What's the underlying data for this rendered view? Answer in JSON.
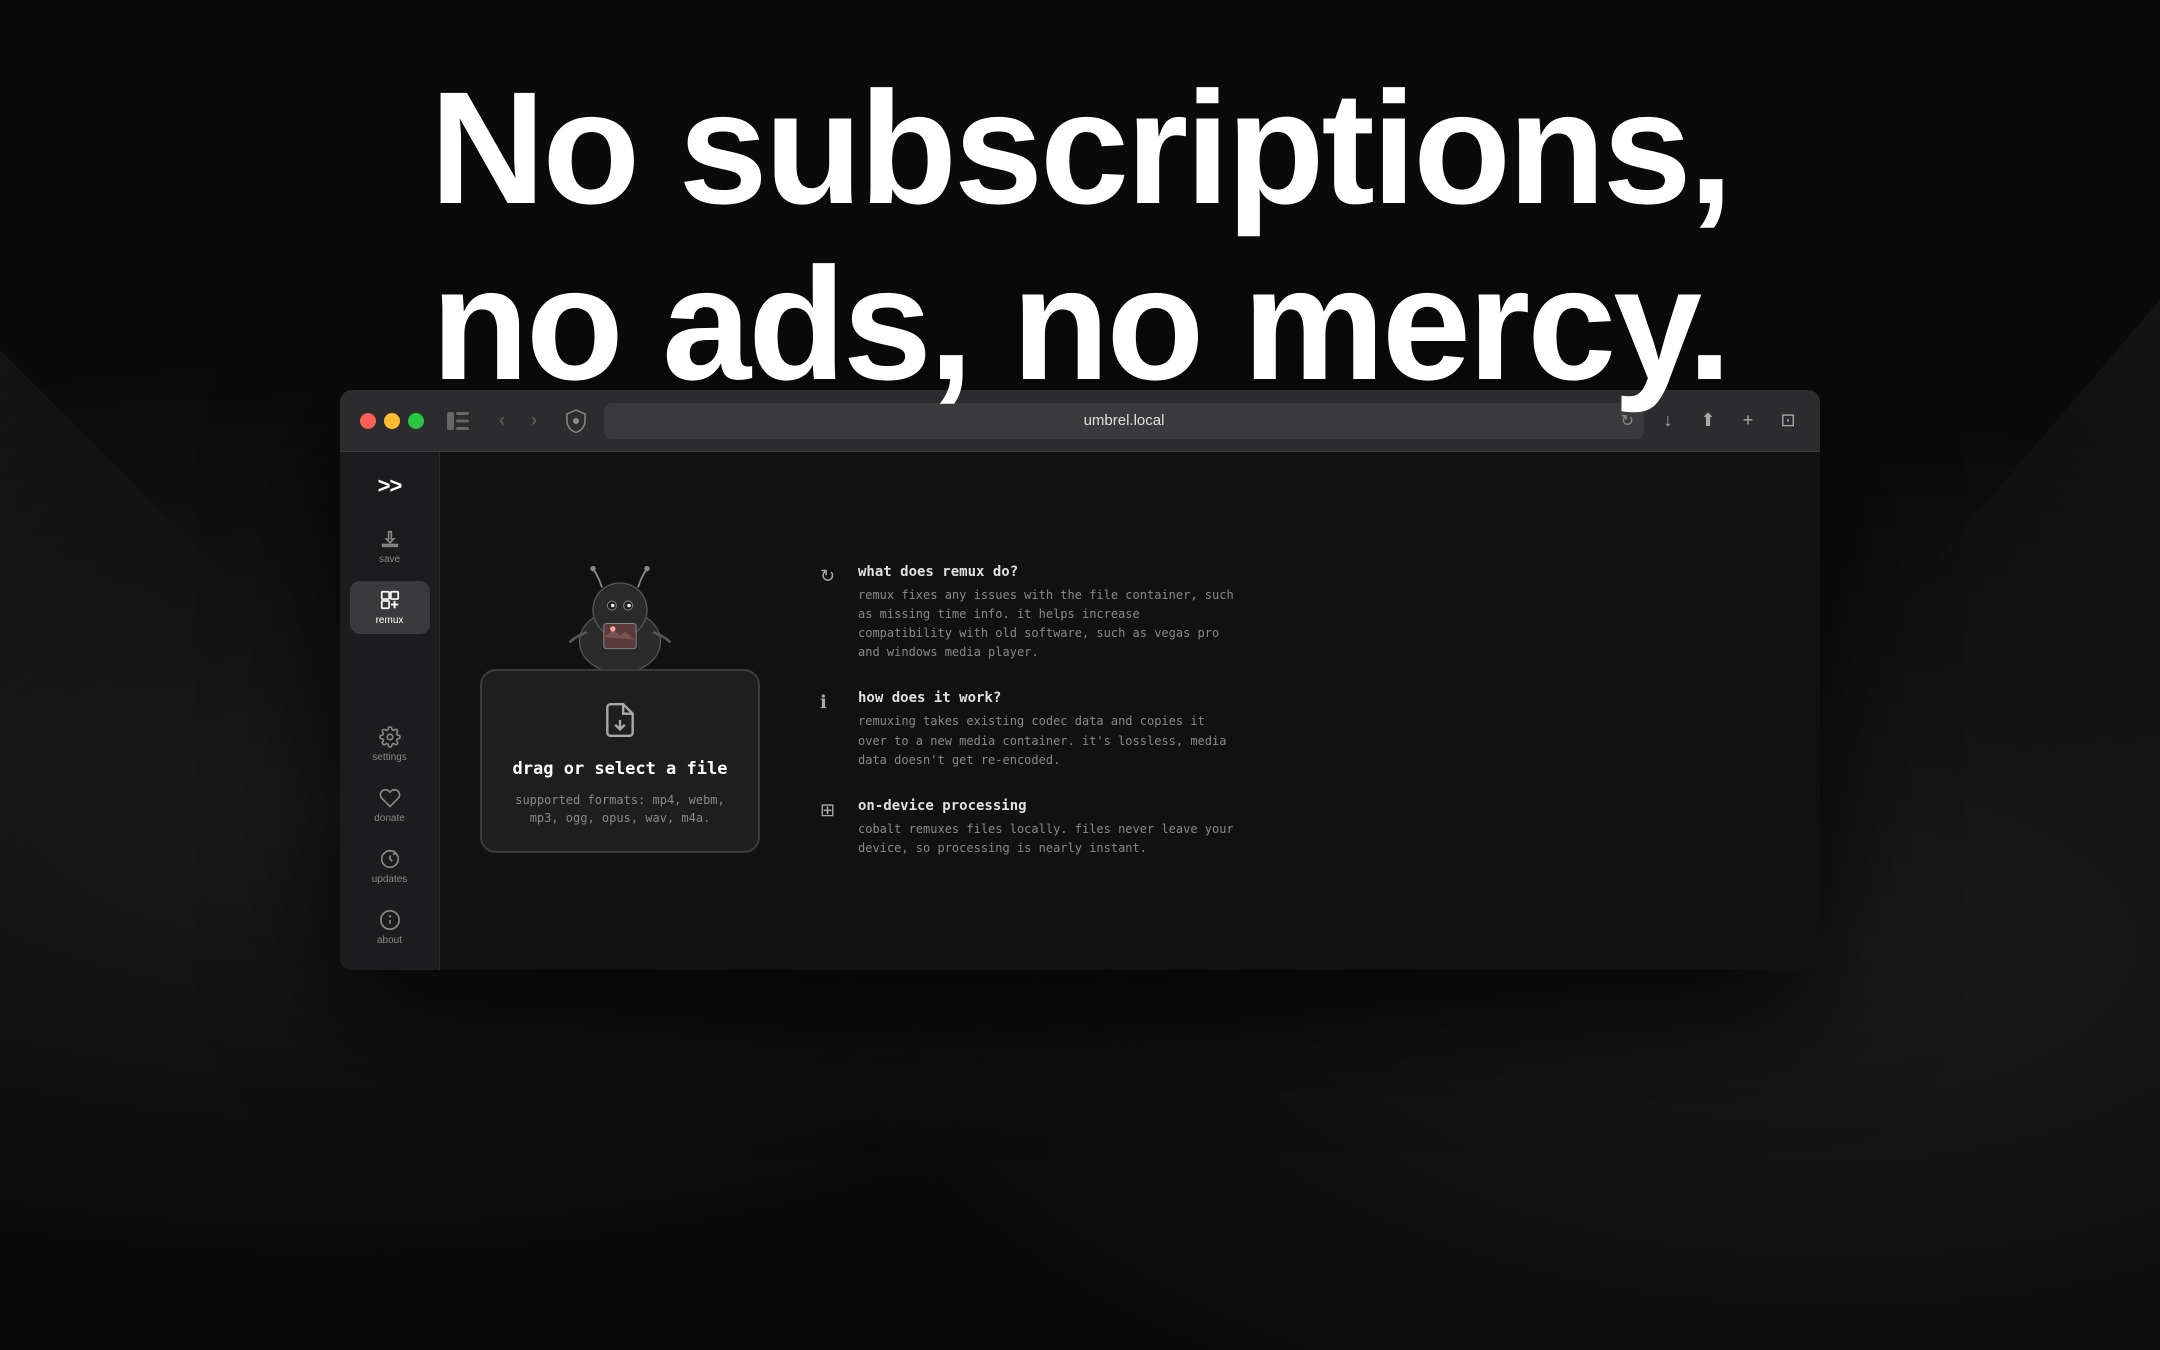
{
  "hero": {
    "line1": "No subscriptions,",
    "line2": "no ads, no mercy."
  },
  "browser": {
    "url": "umbrel.local",
    "traffic_lights": [
      "red",
      "yellow",
      "green"
    ]
  },
  "sidebar": {
    "logo_icon": ">>",
    "items": [
      {
        "id": "save",
        "label": "save",
        "active": false
      },
      {
        "id": "remux",
        "label": "remux",
        "active": true
      }
    ],
    "bottom_items": [
      {
        "id": "settings",
        "label": "settings"
      },
      {
        "id": "donate",
        "label": "donate"
      },
      {
        "id": "updates",
        "label": "updates"
      },
      {
        "id": "about",
        "label": "about"
      }
    ]
  },
  "dropzone": {
    "title": "drag or select a file",
    "subtitle": "supported formats: mp4, webm,\nmp3, ogg, opus, wav, m4a."
  },
  "info_panel": {
    "items": [
      {
        "id": "what",
        "icon": "↻",
        "heading": "what does remux do?",
        "desc": "remux fixes any issues with the file container,\nsuch as missing time info. it helps increase\ncompatibility with old software, such as vegas pro\nand windows media player."
      },
      {
        "id": "how",
        "icon": "ℹ",
        "heading": "how does it work?",
        "desc": "remuxing takes existing codec data and copies it\nover to a new media container. it's lossless, media\ndata doesn't get re-encoded."
      },
      {
        "id": "ondevice",
        "icon": "⊞",
        "heading": "on-device processing",
        "desc": "cobalt remuxes files locally. files never leave\nyour device, so processing is nearly instant."
      }
    ]
  }
}
